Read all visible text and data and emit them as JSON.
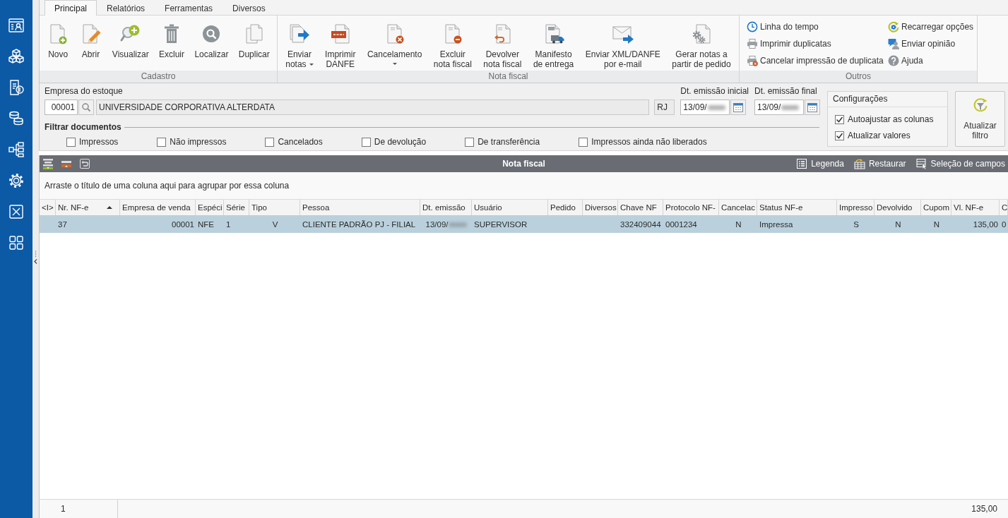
{
  "ribbon": {
    "tabs": [
      {
        "label": "Principal",
        "selected": true
      },
      {
        "label": "Relatórios",
        "selected": false
      },
      {
        "label": "Ferramentas",
        "selected": false
      },
      {
        "label": "Diversos",
        "selected": false
      }
    ],
    "groups": [
      {
        "title": "Cadastro",
        "kind": "large",
        "buttons": [
          {
            "label": "Novo",
            "menu": false
          },
          {
            "label": "Abrir",
            "menu": false
          },
          {
            "label": "Visualizar",
            "menu": false
          },
          {
            "label": "Excluir",
            "menu": false
          },
          {
            "label": "Localizar",
            "menu": false
          },
          {
            "label": "Duplicar",
            "menu": false
          }
        ]
      },
      {
        "title": "Nota fiscal",
        "kind": "large",
        "buttons": [
          {
            "label": "Enviar\nnotas",
            "menu": true
          },
          {
            "label": "Imprimir\nDANFE",
            "menu": false
          },
          {
            "label": "Cancelamento",
            "menu": true
          },
          {
            "label": "Excluir\nnota fiscal",
            "menu": false
          },
          {
            "label": "Devolver\nnota fiscal",
            "menu": false
          },
          {
            "label": "Manifesto\nde entrega",
            "menu": false
          },
          {
            "label": "Enviar XML/DANFE\npor e-mail",
            "menu": false
          },
          {
            "label": "Gerar notas a\npartir de pedido",
            "menu": false
          }
        ]
      },
      {
        "title": "Outros",
        "kind": "small",
        "buttons": [
          {
            "label": "Linha do tempo"
          },
          {
            "label": "Imprimir duplicatas"
          },
          {
            "label": "Cancelar impressão de duplicata"
          },
          {
            "label": "Recarregar opções"
          },
          {
            "label": "Enviar opinião"
          },
          {
            "label": "Ajuda"
          }
        ]
      }
    ]
  },
  "filter": {
    "company": {
      "label": "Empresa do estoque",
      "code": "00001",
      "name": "UNIVERSIDADE CORPORATIVA ALTERDATA",
      "state": "RJ"
    },
    "dates": [
      {
        "label": "Dt. emissão inicial",
        "value": "13/09/",
        "redacted": true
      },
      {
        "label": "Dt. emissão final",
        "value": "13/09/",
        "redacted": true
      }
    ],
    "documents": {
      "title": "Filtrar documentos",
      "options": [
        {
          "label": "Impressos",
          "checked": false
        },
        {
          "label": "Não impressos",
          "checked": false
        },
        {
          "label": "Cancelados",
          "checked": false
        },
        {
          "label": "De devolução",
          "checked": false
        },
        {
          "label": "De transferência",
          "checked": false
        },
        {
          "label": "Impressos ainda não liberados",
          "checked": false
        }
      ]
    },
    "settings": {
      "title": "Configurações",
      "options": [
        {
          "label": "Autoajustar as colunas",
          "checked": true
        },
        {
          "label": "Atualizar valores",
          "checked": true
        }
      ]
    },
    "refresh_button": "Atualizar\nfiltro"
  },
  "grid": {
    "toolbar": {
      "title": "Nota fiscal",
      "actions": [
        "Legenda",
        "Restaurar",
        "Seleção de campos"
      ]
    },
    "group_hint": "Arraste o título de uma coluna aqui para agrupar por essa coluna",
    "columns": [
      {
        "label": "<I>",
        "sorted": false,
        "redacted": false
      },
      {
        "label": "Nr. NF-e",
        "sorted": true,
        "redacted": false
      },
      {
        "label": "Empresa de venda",
        "sorted": false,
        "redacted": false
      },
      {
        "label": "Espéci",
        "sorted": false,
        "redacted": false
      },
      {
        "label": "Série",
        "sorted": false,
        "redacted": false
      },
      {
        "label": "Tipo",
        "sorted": false,
        "redacted": false
      },
      {
        "label": "Pessoa",
        "sorted": false,
        "redacted": false
      },
      {
        "label": "Dt. emissão",
        "sorted": false,
        "redacted": true
      },
      {
        "label": "Usuário",
        "sorted": false,
        "redacted": false
      },
      {
        "label": "Pedido",
        "sorted": false,
        "redacted": false
      },
      {
        "label": "Diversos",
        "sorted": false,
        "redacted": false
      },
      {
        "label": "Chave NF",
        "sorted": false,
        "redacted": false
      },
      {
        "label": "Protocolo NF-",
        "sorted": false,
        "redacted": false
      },
      {
        "label": "Cancelac",
        "sorted": false,
        "redacted": false
      },
      {
        "label": "Status NF-e",
        "sorted": false,
        "redacted": false
      },
      {
        "label": "Impresso",
        "sorted": false,
        "redacted": false
      },
      {
        "label": "Devolvido",
        "sorted": false,
        "redacted": false
      },
      {
        "label": "Cupom",
        "sorted": false,
        "redacted": false
      },
      {
        "label": "Vl. NF-e",
        "sorted": false,
        "redacted": false
      },
      {
        "label": "C",
        "sorted": false,
        "redacted": false
      }
    ],
    "rows": [
      {
        "selected": true,
        "cells": [
          null,
          "37",
          "00001",
          "NFE",
          "1",
          "V",
          "CLIENTE PADRÃO PJ - FILIAL",
          "13/09/",
          "SUPERVISOR",
          null,
          null,
          "332409044",
          "0001234",
          "N",
          "Impressa",
          "S",
          "N",
          "N",
          "135,00",
          "0"
        ]
      }
    ]
  },
  "status_bar": {
    "record_count": "1",
    "total": "135,00"
  }
}
